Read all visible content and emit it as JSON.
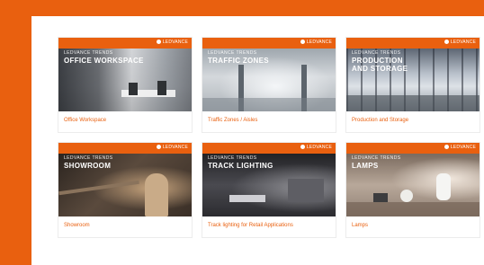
{
  "brand": {
    "name": "LEDVANCE"
  },
  "cards": [
    {
      "tag": "LEDVANCE TRENDS",
      "title": "OFFICE WORKSPACE",
      "caption": "Office Workspace",
      "scene": "office"
    },
    {
      "tag": "LEDVANCE TRENDS",
      "title": "TRAFFIC ZONES",
      "caption": "Traffic Zones / Aisles",
      "scene": "traffic"
    },
    {
      "tag": "LEDVANCE TRENDS",
      "title": "PRODUCTION\nAND STORAGE",
      "caption": "Production and Storage",
      "scene": "production"
    },
    {
      "tag": "LEDVANCE TRENDS",
      "title": "SHOWROOM",
      "caption": "Showroom",
      "scene": "showroom"
    },
    {
      "tag": "LEDVANCE TRENDS",
      "title": "TRACK LIGHTING",
      "caption": "Track lighting for Retail Applications",
      "scene": "track"
    },
    {
      "tag": "LEDVANCE TRENDS",
      "title": "LAMPS",
      "caption": "Lamps",
      "scene": "lamps"
    }
  ],
  "colors": {
    "accent": "#e9600f",
    "page": "#ffffff"
  }
}
